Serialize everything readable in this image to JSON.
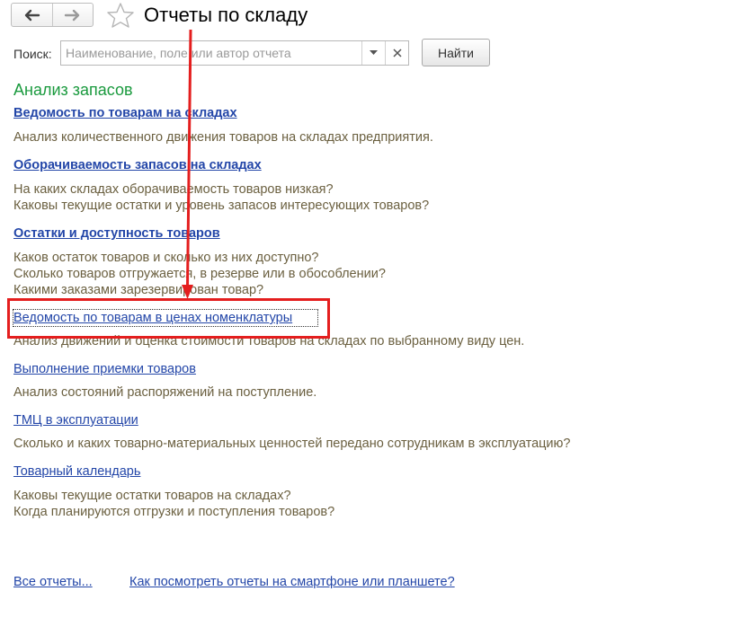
{
  "header": {
    "title": "Отчеты по складу",
    "back_icon": "arrow-left-icon",
    "forward_icon": "arrow-right-icon",
    "favorite_icon": "star-outline-icon"
  },
  "search": {
    "label": "Поиск:",
    "placeholder": "Наименование, поле или автор отчета",
    "value": "",
    "button_label": "Найти"
  },
  "section": {
    "title": "Анализ запасов"
  },
  "reports": [
    {
      "title": "Ведомость по товарам на складах",
      "bold": true,
      "lines": [
        "Анализ количественного движения товаров на складах предприятия."
      ]
    },
    {
      "title": "Оборачиваемость запасов на складах",
      "bold": true,
      "lines": [
        "На каких складах оборачиваемость товаров низкая?",
        "Каковы текущие остатки и уровень запасов интересующих товаров?"
      ]
    },
    {
      "title": "Остатки и доступность товаров",
      "bold": true,
      "lines": [
        "Каков остаток товаров и сколько из них доступно?",
        "Сколько товаров отгружается, в резерве или в обособлении?",
        "Какими заказами зарезервирован товар?"
      ]
    },
    {
      "title": "Ведомость по товарам в ценах номенклатуры",
      "bold": false,
      "lines": [
        "Анализ движений и оценка стоимости товаров на складах по выбранному виду цен."
      ]
    },
    {
      "title": "Выполнение приемки товаров",
      "bold": false,
      "lines": [
        "Анализ состояний распоряжений на поступление."
      ]
    },
    {
      "title": "ТМЦ в эксплуатации",
      "bold": false,
      "lines": [
        "Сколько и каких товарно-материальных ценностей передано сотрудникам в эксплуатацию?"
      ]
    },
    {
      "title": "Товарный календарь",
      "bold": false,
      "lines": [
        "Каковы текущие остатки товаров на складах?",
        "Когда планируются отгрузки и поступления товаров?"
      ]
    }
  ],
  "footer": {
    "all_reports": "Все отчеты...",
    "mobile_help": "Как посмотреть отчеты на смартфоне или планшете?"
  },
  "colors": {
    "section_title": "#1a9a3e",
    "link": "#2346a8",
    "description": "#6b6040",
    "annotation": "#e41e1e"
  }
}
